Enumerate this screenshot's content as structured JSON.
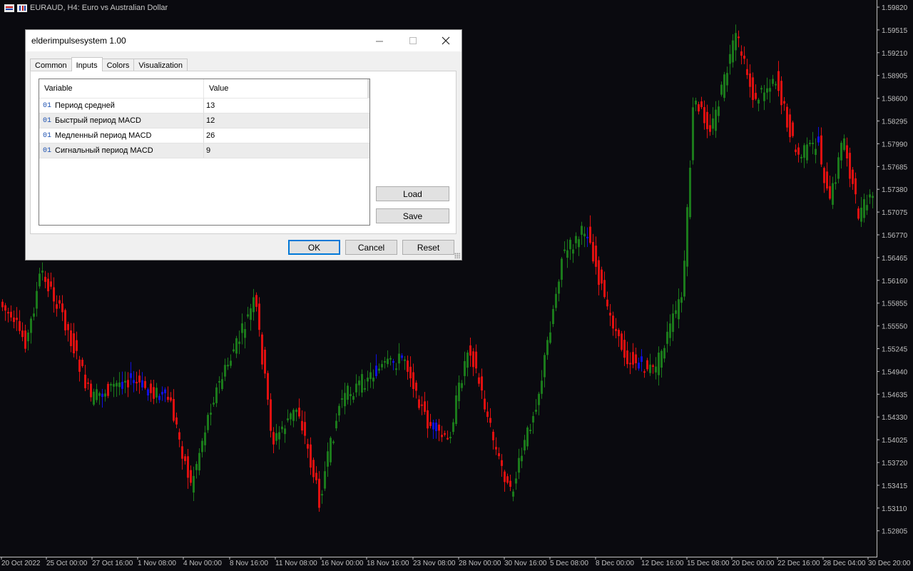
{
  "chart": {
    "symbol_label": "EURAUD, H4:  Euro vs Australian Dollar",
    "price_labels": [
      "1.59820",
      "1.59515",
      "1.59210",
      "1.58905",
      "1.58600",
      "1.58295",
      "1.57990",
      "1.57685",
      "1.57380",
      "1.57075",
      "1.56770",
      "1.56465",
      "1.56160",
      "1.55855",
      "1.55550",
      "1.55245",
      "1.54940",
      "1.54635",
      "1.54330",
      "1.54025",
      "1.53720",
      "1.53415",
      "1.53110",
      "1.52805"
    ],
    "date_labels": [
      "20 Oct 2022",
      "25 Oct 00:00",
      "27 Oct 16:00",
      "1 Nov 08:00",
      "4 Nov 00:00",
      "8 Nov 16:00",
      "11 Nov 08:00",
      "16 Nov 00:00",
      "18 Nov 16:00",
      "23 Nov 08:00",
      "28 Nov 00:00",
      "30 Nov 16:00",
      "5 Dec 08:00",
      "8 Dec 00:00",
      "12 Dec 16:00",
      "15 Dec 08:00",
      "20 Dec 00:00",
      "22 Dec 16:00",
      "28 Dec 04:00",
      "30 Dec 20:00"
    ],
    "colors": {
      "background": "#0a0a0f",
      "up": "#1b7a1b",
      "down": "#e01010",
      "neutral": "#1010e0",
      "axis": "#c0c0c0"
    }
  },
  "dialog": {
    "title": "elderimpulsesystem 1.00",
    "tabs": [
      {
        "label": "Common"
      },
      {
        "label": "Inputs"
      },
      {
        "label": "Colors"
      },
      {
        "label": "Visualization"
      }
    ],
    "table": {
      "headers": {
        "variable": "Variable",
        "value": "Value"
      },
      "row_icon": "01",
      "rows": [
        {
          "variable": "Период средней",
          "value": "13"
        },
        {
          "variable": "Быстрый период MACD",
          "value": "12"
        },
        {
          "variable": "Медленный период MACD",
          "value": "26"
        },
        {
          "variable": "Сигнальный период MACD",
          "value": "9"
        }
      ]
    },
    "buttons": {
      "load": "Load",
      "save": "Save",
      "ok": "OK",
      "cancel": "Cancel",
      "reset": "Reset"
    },
    "window_controls": {
      "minimize": "minimize-icon",
      "maximize": "maximize-icon",
      "close": "close-icon"
    }
  }
}
